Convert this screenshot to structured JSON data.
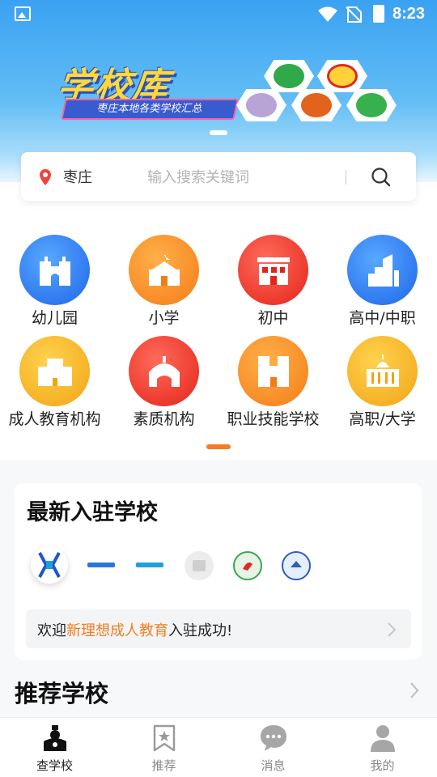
{
  "status_bar": {
    "time": "8:23"
  },
  "banner": {
    "title": "学校库",
    "subtitle": "枣庄本地各类学校汇总"
  },
  "search": {
    "city": "枣庄",
    "placeholder": "输入搜索关键词"
  },
  "categories": [
    {
      "label": "幼儿园",
      "color": "blue",
      "icon": "kindergarten-castle-icon"
    },
    {
      "label": "小学",
      "color": "orange",
      "icon": "primary-school-icon"
    },
    {
      "label": "初中",
      "color": "red",
      "icon": "middle-school-icon"
    },
    {
      "label": "高中/中职",
      "color": "blue",
      "icon": "high-school-building-icon"
    },
    {
      "label": "成人教育机构",
      "color": "yellow",
      "icon": "adult-education-building-icon"
    },
    {
      "label": "素质机构",
      "color": "red",
      "icon": "quality-institution-icon"
    },
    {
      "label": "职业技能学校",
      "color": "orange",
      "icon": "vocational-school-icon"
    },
    {
      "label": "高职/大学",
      "color": "yellow",
      "icon": "university-icon"
    }
  ],
  "newest": {
    "title": "最新入驻学校",
    "welcome_prefix": "欢迎",
    "welcome_highlight": "新理想成人教育",
    "welcome_suffix": "入驻成功!"
  },
  "recommend": {
    "title": "推荐学校"
  },
  "tabs": [
    {
      "label": "查学校",
      "icon": "school-search-icon",
      "active": true
    },
    {
      "label": "推荐",
      "icon": "bookmark-star-icon",
      "active": false
    },
    {
      "label": "消息",
      "icon": "chat-bubble-icon",
      "active": false
    },
    {
      "label": "我的",
      "icon": "person-icon",
      "active": false
    }
  ],
  "colors": {
    "accent": "#f57d1f",
    "hero_blue": "#3aa2f2",
    "icon_blue": "#1e66e9",
    "icon_orange": "#f47c16",
    "icon_red": "#e4241a",
    "icon_yellow": "#f2a414"
  }
}
